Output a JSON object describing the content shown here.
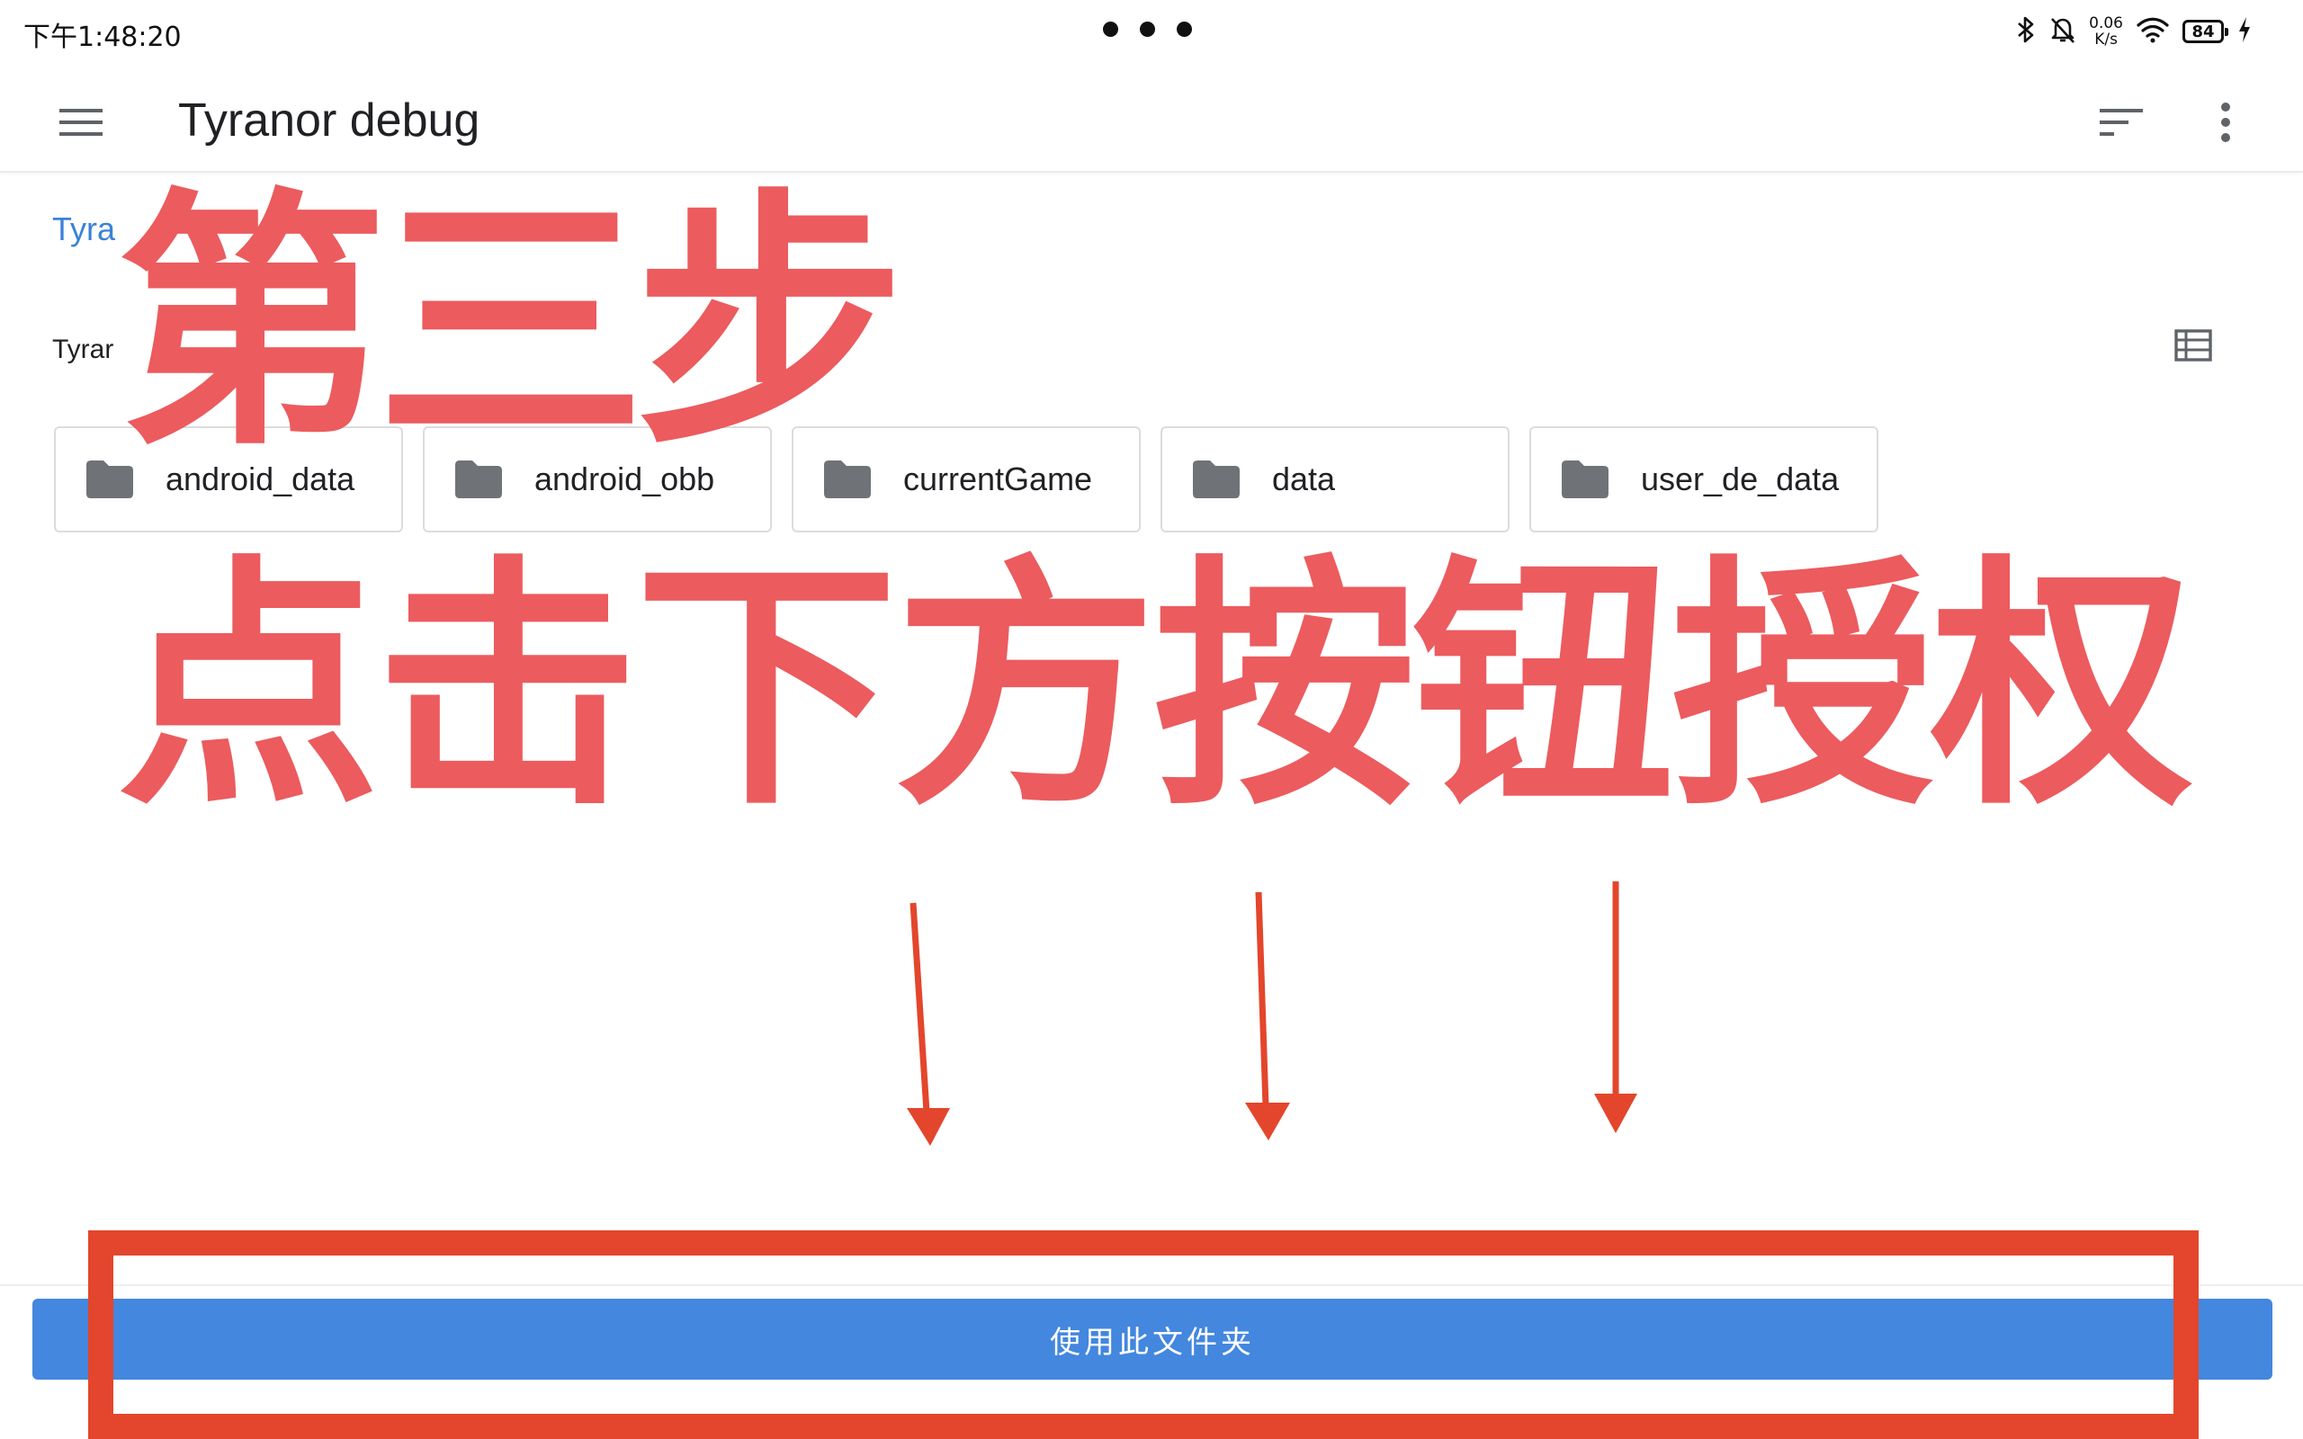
{
  "status_bar": {
    "time": "下午1:48:20",
    "net_speed_value": "0.06",
    "net_speed_unit": "K/s",
    "battery": "84"
  },
  "app_bar": {
    "title": "Tyranor debug"
  },
  "breadcrumb": {
    "root": "Tyra"
  },
  "folder_path": "Tyrar",
  "folders": [
    {
      "name": "android_data"
    },
    {
      "name": "android_obb"
    },
    {
      "name": "currentGame"
    },
    {
      "name": "data"
    },
    {
      "name": "user_de_data"
    }
  ],
  "overlay": {
    "step": "第三步",
    "instruction": "点击下方按钮授权",
    "color": "#ec5b5e"
  },
  "action": {
    "use_folder_label": "使用此文件夹",
    "button_color": "#4387de",
    "highlight_color": "#e3462c"
  },
  "icons": {
    "menu": "menu-icon",
    "sort": "sort-icon",
    "more": "more-vert-icon",
    "view": "list-view-icon",
    "folder": "folder-icon"
  }
}
